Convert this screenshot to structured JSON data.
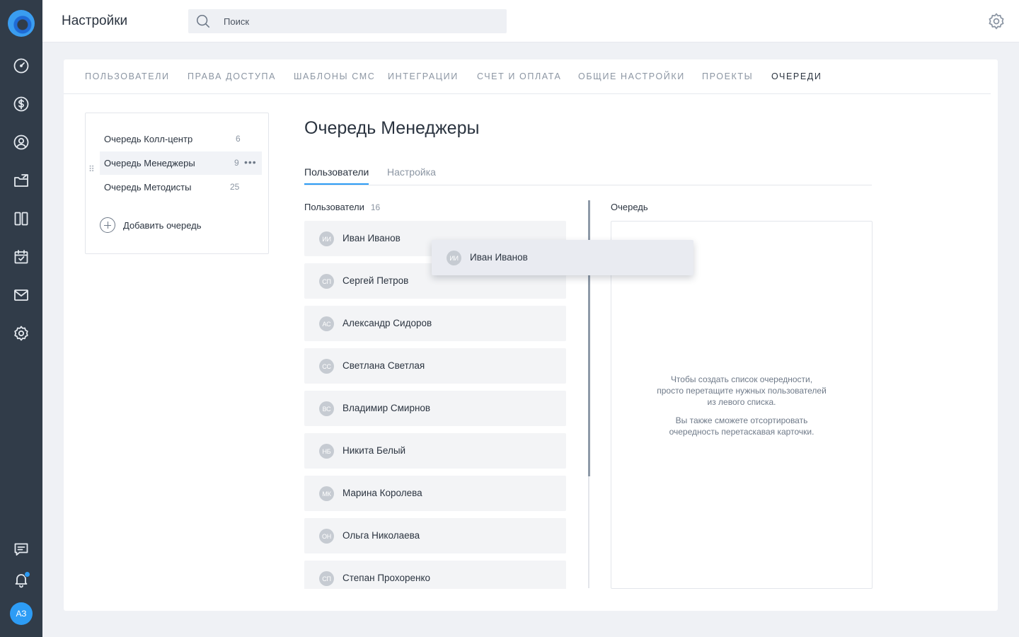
{
  "header": {
    "title": "Настройки",
    "search_placeholder": "Поиск"
  },
  "user": {
    "initials": "АЗ"
  },
  "tabs": [
    {
      "label": "Пользователи"
    },
    {
      "label": "Права доступа"
    },
    {
      "label": "Шаблоны СМС"
    },
    {
      "label": "Интеграции"
    },
    {
      "label": "Счет и оплата"
    },
    {
      "label": "Общие настройки"
    },
    {
      "label": "Проекты"
    },
    {
      "label": "Очереди",
      "active": true
    }
  ],
  "queues": {
    "items": [
      {
        "name": "Очередь Колл-центр",
        "count": "6"
      },
      {
        "name": "Очередь Менеджеры",
        "count": "9",
        "active": true
      },
      {
        "name": "Очередь Методисты",
        "count": "25"
      }
    ],
    "add_label": "Добавить очередь"
  },
  "queue_detail": {
    "title": "Очередь Менеджеры",
    "subtabs": [
      {
        "label": "Пользователи",
        "active": true
      },
      {
        "label": "Настройка"
      }
    ],
    "users_label": "Пользователи",
    "users_count": "16",
    "queue_label": "Очередь",
    "users": [
      {
        "initials": "ИИ",
        "name": "Иван Иванов"
      },
      {
        "initials": "СП",
        "name": "Сергей Петров"
      },
      {
        "initials": "АС",
        "name": "Александр Сидоров"
      },
      {
        "initials": "СС",
        "name": "Светлана Светлая"
      },
      {
        "initials": "ВС",
        "name": "Владимир Смирнов"
      },
      {
        "initials": "НБ",
        "name": "Никита Белый"
      },
      {
        "initials": "МК",
        "name": "Марина Королева"
      },
      {
        "initials": "ОН",
        "name": "Ольга Николаева"
      },
      {
        "initials": "СП",
        "name": "Степан Прохоренко"
      }
    ],
    "dragging": {
      "initials": "ИИ",
      "name": "Иван Иванов"
    },
    "hint_lines_1": [
      "Чтобы создать список очередности,",
      "просто перетащите нужных пользователей",
      "из левого списка."
    ],
    "hint_lines_2": [
      "Вы также сможете отсортировать",
      "очередность перетаскавая карточки."
    ]
  },
  "colors": {
    "sidebar": "#313c49",
    "accent": "#2d9cf5",
    "background": "#eff1f5"
  }
}
